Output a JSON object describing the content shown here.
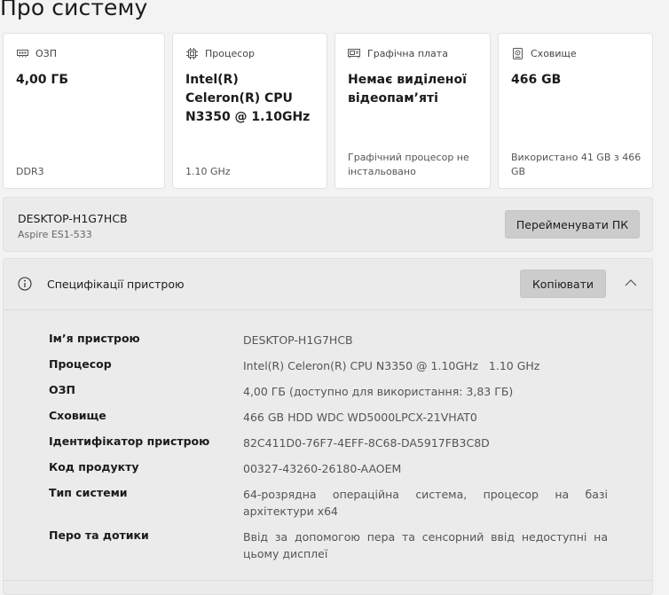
{
  "page": {
    "title": "Про систему"
  },
  "cards": [
    {
      "label": "ОЗП",
      "icon": "ram-icon",
      "value": "4,00 ГБ",
      "footer": "DDR3"
    },
    {
      "label": "Процесор",
      "icon": "cpu-icon",
      "value": "Intel(R) Celeron(R) CPU N3350 @ 1.10GHz",
      "footer": "1.10 GHz"
    },
    {
      "label": "Графічна плата",
      "icon": "gpu-icon",
      "value": "Немає виділеної відеопам’яті",
      "footer": "Графічний процесор не інстальовано"
    },
    {
      "label": "Сховище",
      "icon": "storage-icon",
      "value": "466 GB",
      "footer": "Використано 41 GB з 466 GB"
    }
  ],
  "device": {
    "name": "DESKTOP-H1G7HCB",
    "model": "Aspire ES1-533",
    "rename_label": "Перейменувати ПК"
  },
  "specs": {
    "title": "Специфікації пристрою",
    "copy_label": "Копіювати",
    "rows": [
      {
        "key": "Ім’я пристрою",
        "value": "DESKTOP-H1G7HCB"
      },
      {
        "key": "Процесор",
        "value": "Intel(R) Celeron(R) CPU N3350 @ 1.10GHz   1.10 GHz"
      },
      {
        "key": "ОЗП",
        "value": "4,00 ГБ (доступно для використання: 3,83 ГБ)"
      },
      {
        "key": "Сховище",
        "value": "466 GB HDD WDC WD5000LPCX-21VHAT0"
      },
      {
        "key": "Ідентифікатор пристрою",
        "value": "82C411D0-76F7-4EFF-8C68-DA5917FB3C8D"
      },
      {
        "key": "Код продукту",
        "value": "00327-43260-26180-AAOEM"
      },
      {
        "key": "Тип системи",
        "value": "64-розрядна операційна система, процесор на базі архітектури x64"
      },
      {
        "key": "Перо та дотики",
        "value": "Ввід за допомогою пера та сенсорний ввід недоступні на цьому дисплеї"
      }
    ]
  }
}
